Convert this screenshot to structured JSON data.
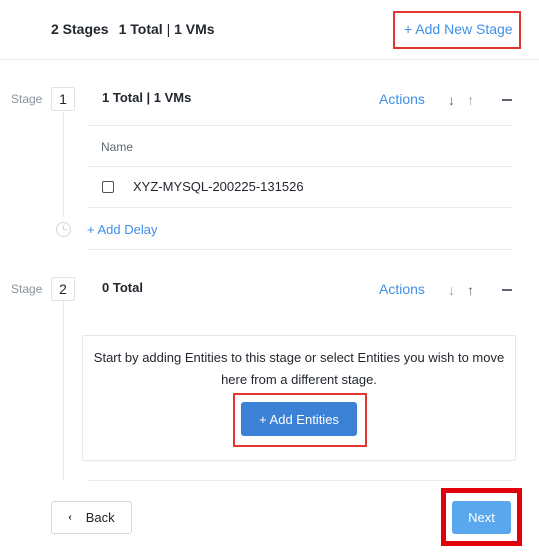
{
  "summary": {
    "stages": "2 Stages",
    "total": "1 Total",
    "separator": "|",
    "vms": "1 VMs"
  },
  "add_new_stage": "+ Add New Stage",
  "stages": [
    {
      "label": "Stage",
      "number": "1",
      "total_text": "1 Total | 1 VMs",
      "actions": "Actions",
      "column_header": "Name",
      "entities": [
        "XYZ-MYSQL-200225-131526"
      ],
      "add_delay": "+ Add Delay"
    },
    {
      "label": "Stage",
      "number": "2",
      "total_text": "0 Total",
      "actions": "Actions",
      "empty_message": "Start by adding Entities to this stage or select Entities you wish to move here from a different stage.",
      "add_entities": "+ Add Entities"
    }
  ],
  "icons": {
    "down_arrow": "↓",
    "up_arrow": "↑",
    "back_chevron": "‹"
  },
  "footer": {
    "back": "Back",
    "next": "Next"
  },
  "colors": {
    "accent": "#3f8fe8",
    "primary_button": "#3b82d6",
    "next_button": "#5aa7ee",
    "highlight": "#e3342f"
  }
}
